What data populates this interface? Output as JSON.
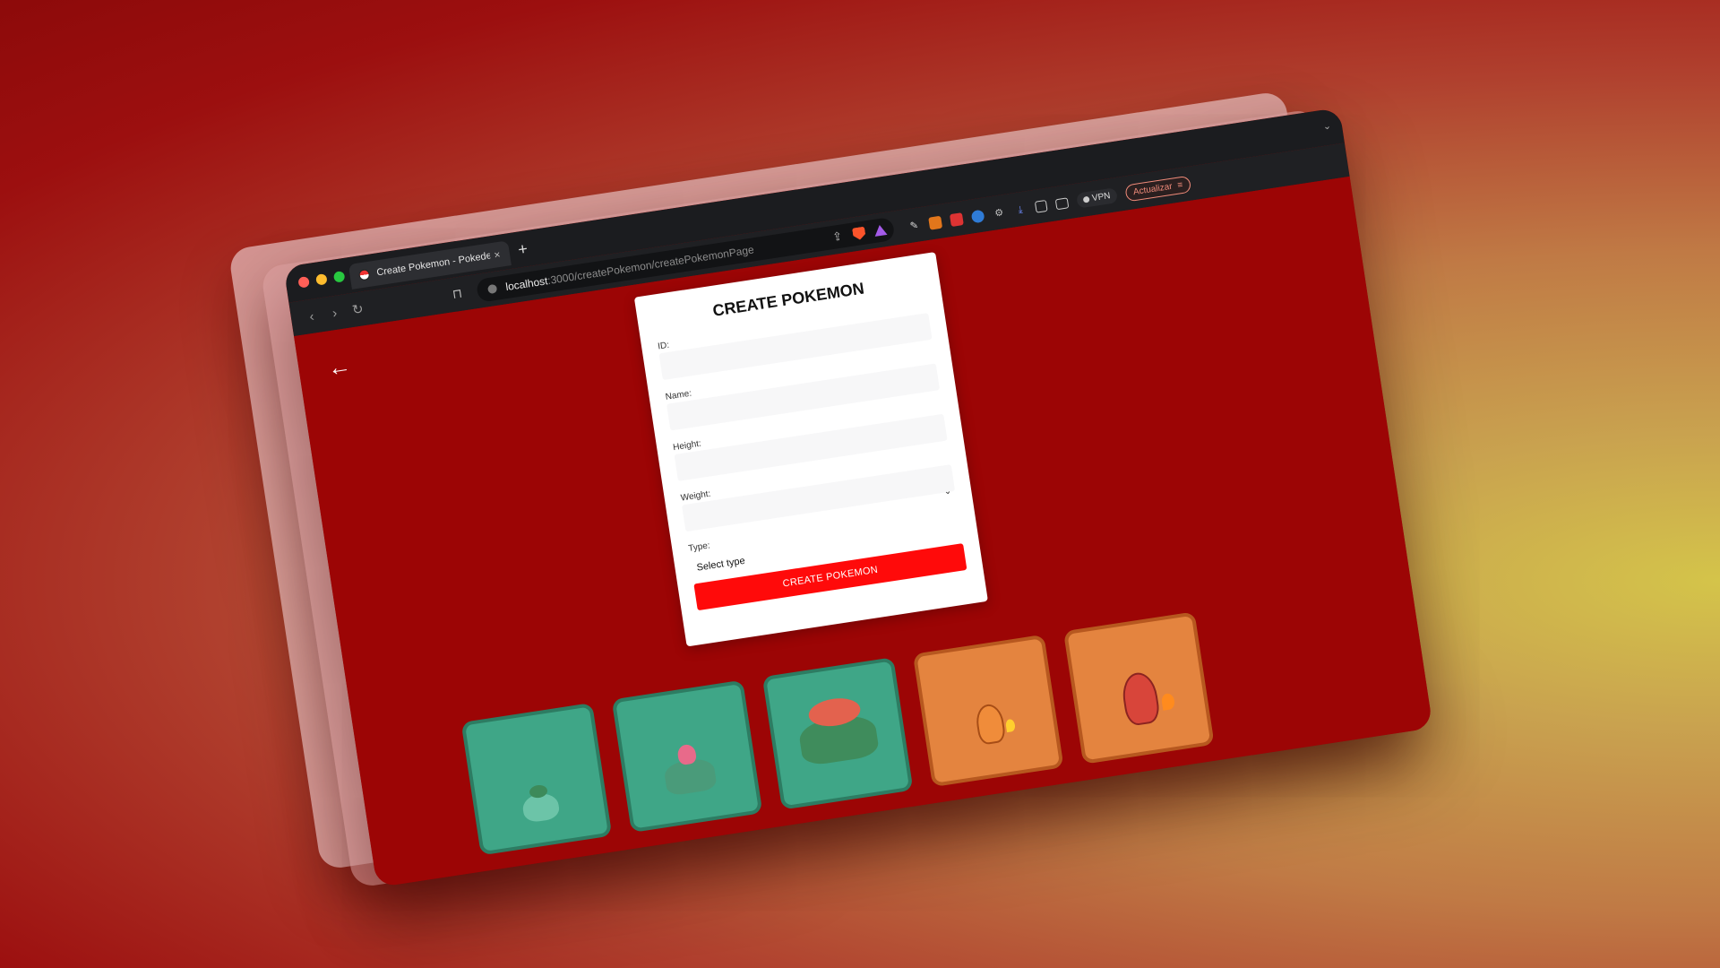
{
  "browser": {
    "tab_title": "Create Pokemon - Pokedex",
    "tab_close": "×",
    "new_tab": "+",
    "url_host": "localhost",
    "url_path": ":3000/createPokemon/createPokemonPage",
    "vpn_label": "VPN",
    "update_label": "Actualizar"
  },
  "page": {
    "back_icon": "←",
    "form": {
      "title": "CREATE POKEMON",
      "fields": {
        "id_label": "ID:",
        "name_label": "Name:",
        "height_label": "Height:",
        "weight_label": "Weight:",
        "type_label": "Type:"
      },
      "type_select_value": "Select type",
      "submit_label": "CREATE POKEMON"
    },
    "cards": [
      {
        "type": "grass",
        "sprite": "bulbasaur-icon"
      },
      {
        "type": "grass",
        "sprite": "ivysaur-icon"
      },
      {
        "type": "grass",
        "sprite": "venusaur-icon"
      },
      {
        "type": "fire",
        "sprite": "charmander-icon"
      },
      {
        "type": "fire",
        "sprite": "charmeleon-icon"
      }
    ]
  },
  "colors": {
    "page_bg": "#9c0505",
    "submit_bg": "#ff0a0a",
    "grass_card": "#3fa687",
    "fire_card": "#e4843f"
  }
}
